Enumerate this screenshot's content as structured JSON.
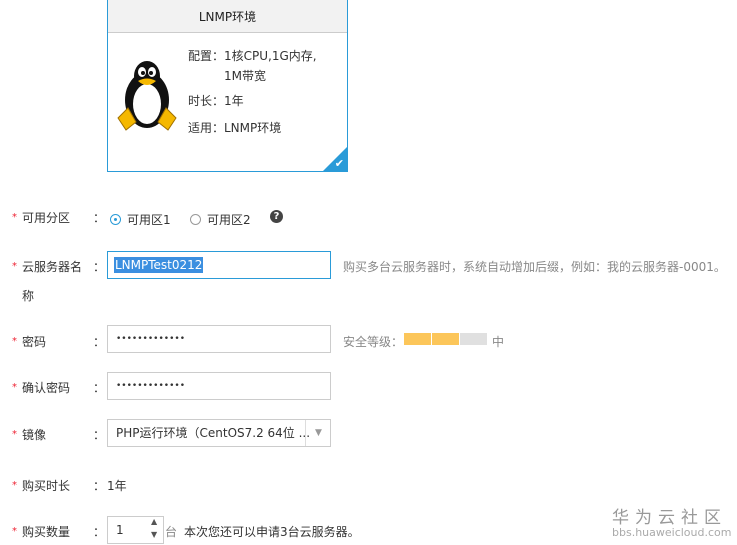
{
  "card": {
    "title": "LNMP环境",
    "config_label": "配置：",
    "config_value_1": "1核CPU,1G内存,",
    "config_value_2": "1M带宽",
    "duration": "时长：1年",
    "usage": "适用：LNMP环境",
    "icon": "linux-penguin-icon"
  },
  "form": {
    "zone": {
      "label": "可用分区",
      "options": [
        "可用区1",
        "可用区2"
      ],
      "selected": "可用区1"
    },
    "name": {
      "label_1": "云服务器名",
      "label_2": "称",
      "value": "LNMPTest0212",
      "hint": "购买多台云服务器时，系统自动增加后缀，例如：我的云服务器-0001。"
    },
    "password": {
      "label": "密码",
      "value": "•••••••••••••",
      "strength_label": "安全等级：",
      "strength_level": "中",
      "strength_filled": 2,
      "strength_total": 3
    },
    "confirm": {
      "label": "确认密码",
      "value": "•••••••••••••"
    },
    "image": {
      "label": "镜像",
      "value": "PHP运行环境（CentOS7.2 64位 ..."
    },
    "duration": {
      "label": "购买时长",
      "value": "1年"
    },
    "quantity": {
      "label": "购买数量",
      "value": "1",
      "unit": "台",
      "hint": "本次您还可以申请3台云服务器。"
    },
    "colon": "：",
    "required": "*"
  },
  "watermark": {
    "title": "华为云社区",
    "url": "bbs.huaweicloud.com"
  },
  "colors": {
    "accent": "#2a9bd8",
    "strength": "#fcc65a",
    "strength_empty": "#e0e0e0"
  }
}
